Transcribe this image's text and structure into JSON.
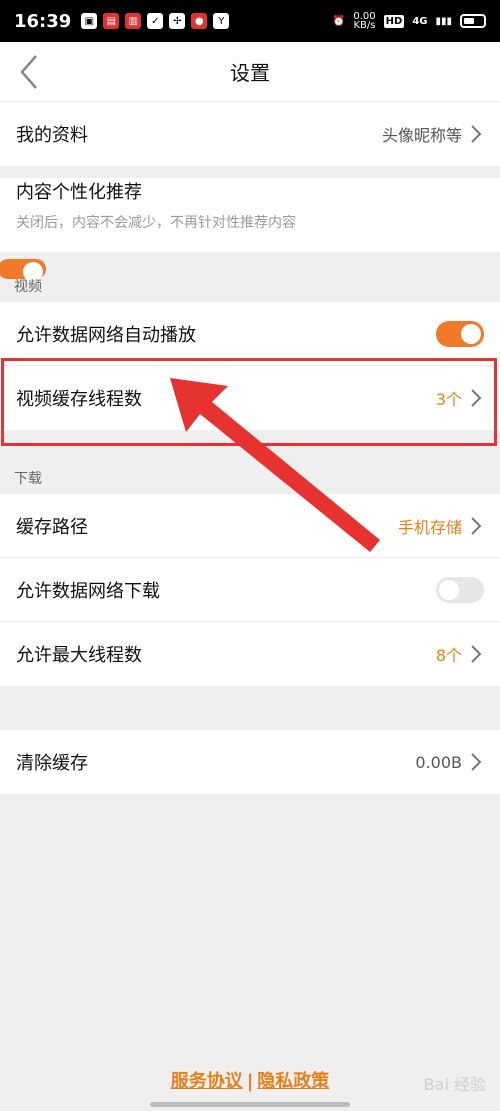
{
  "status_bar": {
    "time": "16:39",
    "net_speed": "0.00\nKB/s",
    "hd": "HD",
    "signal": "4G"
  },
  "nav": {
    "title": "设置"
  },
  "rows": {
    "profile": {
      "label": "我的资料",
      "value": "头像昵称等"
    },
    "personalize": {
      "label": "内容个性化推荐",
      "sub": "关闭后，内容不会减少，不再针对性推荐内容",
      "enabled": true
    },
    "autoplay": {
      "label": "允许数据网络自动播放",
      "enabled": true
    },
    "video_threads": {
      "label": "视频缓存线程数",
      "value": "3个"
    },
    "cache_path": {
      "label": "缓存路径",
      "value": "手机存储"
    },
    "data_download": {
      "label": "允许数据网络下载",
      "enabled": false
    },
    "max_threads": {
      "label": "允许最大线程数",
      "value": "8个"
    },
    "clear_cache": {
      "label": "清除缓存",
      "value": "0.00B"
    }
  },
  "sections": {
    "video": "视频",
    "download": "下载"
  },
  "footer": {
    "service": "服务协议",
    "separator": "|",
    "privacy": "隐私政策"
  },
  "watermark": "Bai 经验",
  "colors": {
    "accent": "#e7801b",
    "toggle_on": "#f07a2a",
    "annotation": "#e63230"
  }
}
